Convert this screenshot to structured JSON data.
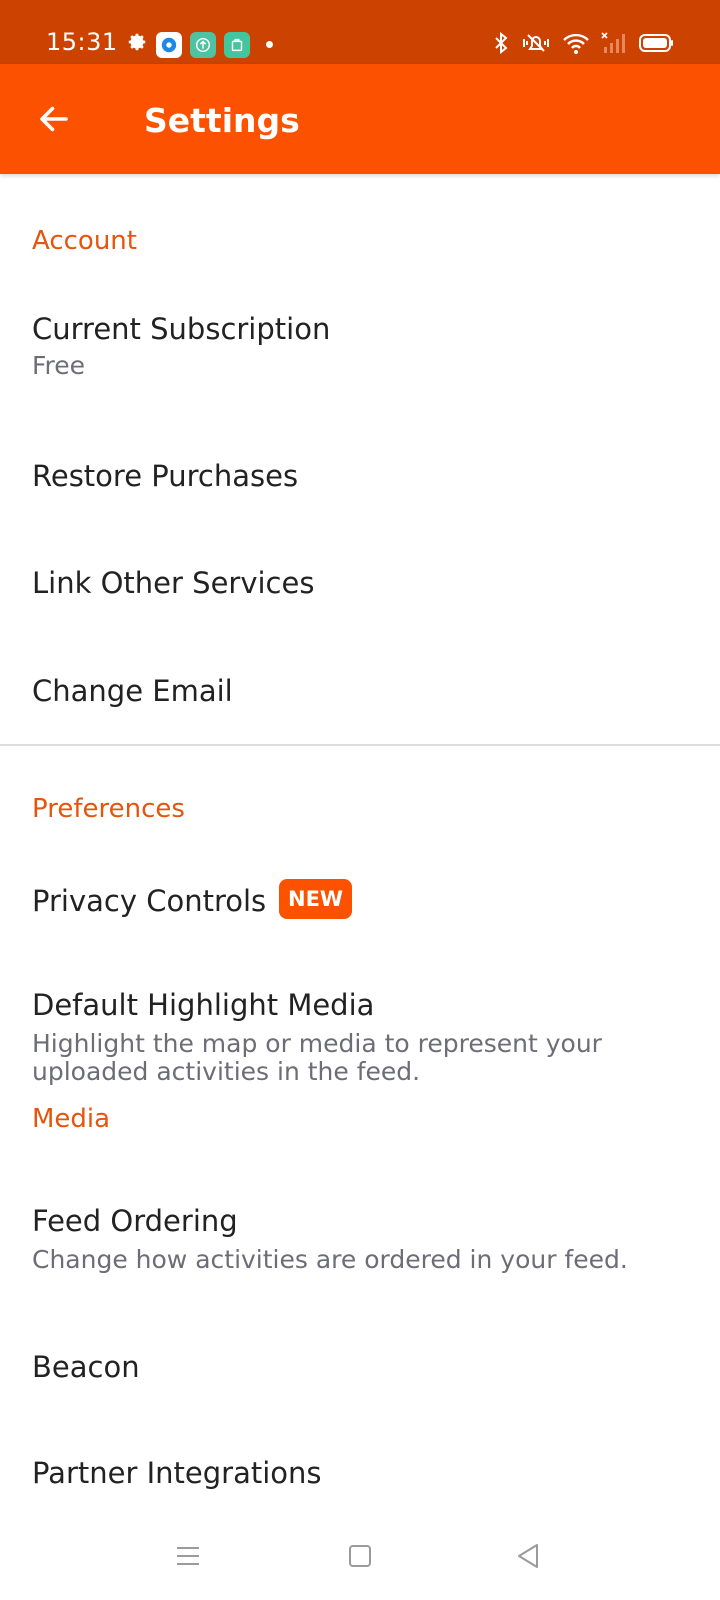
{
  "status_bar": {
    "time": "15:31",
    "left_icons": [
      "gear-icon",
      "app-notification-icon",
      "upload-app-icon",
      "shop-app-icon",
      "dot-icon"
    ],
    "right_icons": [
      "bluetooth-icon",
      "vibrate-icon",
      "wifi-icon",
      "cellular-signal-icon",
      "battery-icon"
    ]
  },
  "app_bar": {
    "title": "Settings",
    "back_icon": "arrow-left-icon",
    "color": "#fc5200"
  },
  "sections": {
    "account": {
      "header": "Account",
      "items": {
        "subscription": {
          "title": "Current Subscription",
          "subtitle": "Free"
        },
        "restore": {
          "title": "Restore Purchases"
        },
        "link": {
          "title": "Link Other Services"
        },
        "email": {
          "title": "Change Email"
        }
      }
    },
    "preferences": {
      "header": "Preferences",
      "items": {
        "privacy": {
          "title": "Privacy Controls",
          "badge": "NEW"
        },
        "highlight": {
          "title": "Default Highlight Media",
          "subtitle": "Highlight the map or media to represent your uploaded activities in the feed.",
          "value": "Media"
        },
        "feed": {
          "title": "Feed Ordering",
          "subtitle": "Change how activities are ordered in your feed."
        },
        "beacon": {
          "title": "Beacon"
        },
        "partner": {
          "title": "Partner Integrations"
        }
      }
    }
  },
  "nav_bar": {
    "icons": [
      "menu-icon",
      "home-square-icon",
      "back-triangle-icon"
    ]
  },
  "colors": {
    "accent": "#fc5200",
    "status_bar": "#cc4200",
    "section_header": "#e4560d"
  }
}
